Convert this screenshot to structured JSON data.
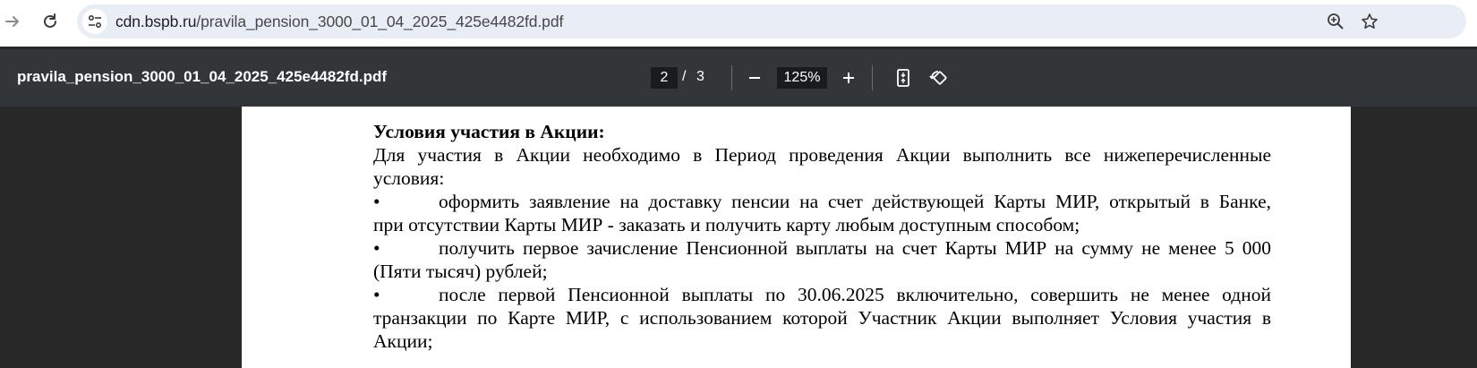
{
  "browser": {
    "url_host": "cdn.bspb.ru",
    "url_path": "/pravila_pension_3000_01_04_2025_425e4482fd.pdf"
  },
  "pdf_toolbar": {
    "title": "pravila_pension_3000_01_04_2025_425e4482fd.pdf",
    "current_page": "2",
    "page_separator": "/",
    "total_pages": "3",
    "zoom": "125%"
  },
  "document": {
    "heading": "Условия участия в Акции:",
    "intro_line1": "Для участия в Акции необходимо в Период проведения Акции выполнить все нижеперечисленные",
    "intro_line2": "условия:",
    "bullet_mark": "•",
    "bullet1_line1": "оформить заявление на доставку пенсии на счет действующей Карты МИР, открытый в Банке,",
    "bullet1_line2": "при отсутствии Карты МИР - заказать и получить карту любым доступным способом;",
    "bullet2_line1": "получить первое зачисление Пенсионной выплаты на счет Карты МИР на сумму не менее 5 000",
    "bullet2_line2": "(Пяти тысяч) рублей;",
    "bullet3_line1": "после первой Пенсионной выплаты по 30.06.2025 включительно, совершить не менее одной",
    "bullet3_line2": "транзакции по Карте МИР, с использованием которой Участник Акции выполняет Условия участия в",
    "bullet3_line3": "Акции;"
  }
}
